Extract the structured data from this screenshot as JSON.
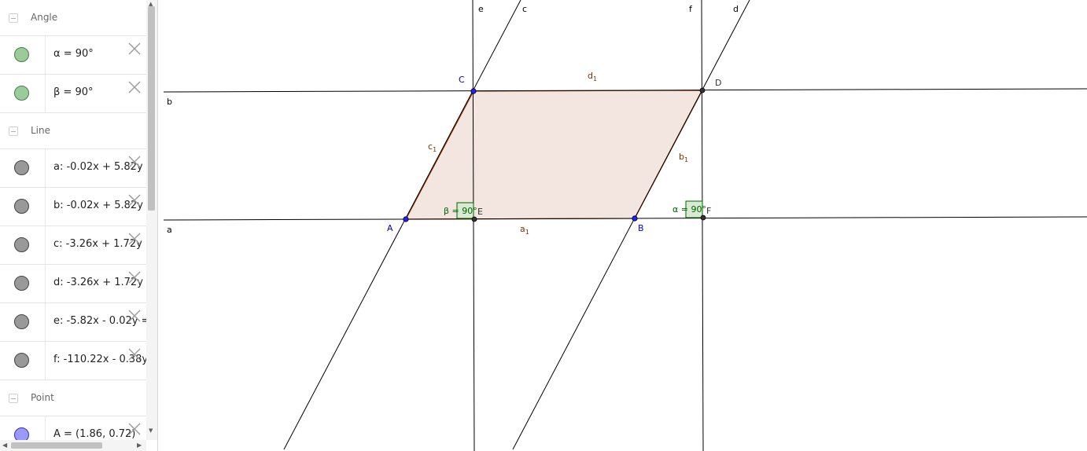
{
  "algebra": {
    "groups": [
      {
        "title": "Angle",
        "items": [
          {
            "text": "α = 90°",
            "color": "#99cc99"
          },
          {
            "text": "β = 90°",
            "color": "#99cc99"
          }
        ]
      },
      {
        "title": "Line",
        "items": [
          {
            "text": "a: -0.02x + 5.82y = ",
            "color": "#999999"
          },
          {
            "text": "b: -0.02x + 5.82y = ",
            "color": "#999999"
          },
          {
            "text": "c: -3.26x + 1.72y = ",
            "color": "#999999"
          },
          {
            "text": "d: -3.26x + 1.72y = ",
            "color": "#999999"
          },
          {
            "text": "e: -5.82x - 0.02y = ",
            "color": "#999999"
          },
          {
            "text": "f: -110.22x - 0.38y = ",
            "color": "#999999"
          }
        ]
      },
      {
        "title": "Point",
        "items": [
          {
            "text": "A = (1.86, 0.72)",
            "color": "#9999ff"
          }
        ]
      }
    ]
  },
  "graphics": {
    "line_labels": {
      "a": "a",
      "b": "b",
      "c": "c",
      "d": "d",
      "e": "e",
      "f": "f"
    },
    "point_labels": {
      "A": "A",
      "B": "B",
      "C": "C",
      "D": "D",
      "E": "E",
      "F": "F"
    },
    "segment_labels": {
      "a1": {
        "base": "a",
        "sub": "1"
      },
      "b1": {
        "base": "b",
        "sub": "1"
      },
      "c1": {
        "base": "c",
        "sub": "1"
      },
      "d1": {
        "base": "d",
        "sub": "1"
      }
    },
    "angle_labels": {
      "alpha": "α = 90°",
      "beta": "β = 90°"
    },
    "colors": {
      "polygon_fill": "#f3e6e0",
      "polygon_stroke": "#993300",
      "line": "#000000",
      "free_point": "#1f1fff",
      "dependent_point": "#333333",
      "angle": "#006400",
      "angle_fill": "#d9ead3",
      "point_label": "#0000cc",
      "segment_label": "#7a3300"
    }
  }
}
